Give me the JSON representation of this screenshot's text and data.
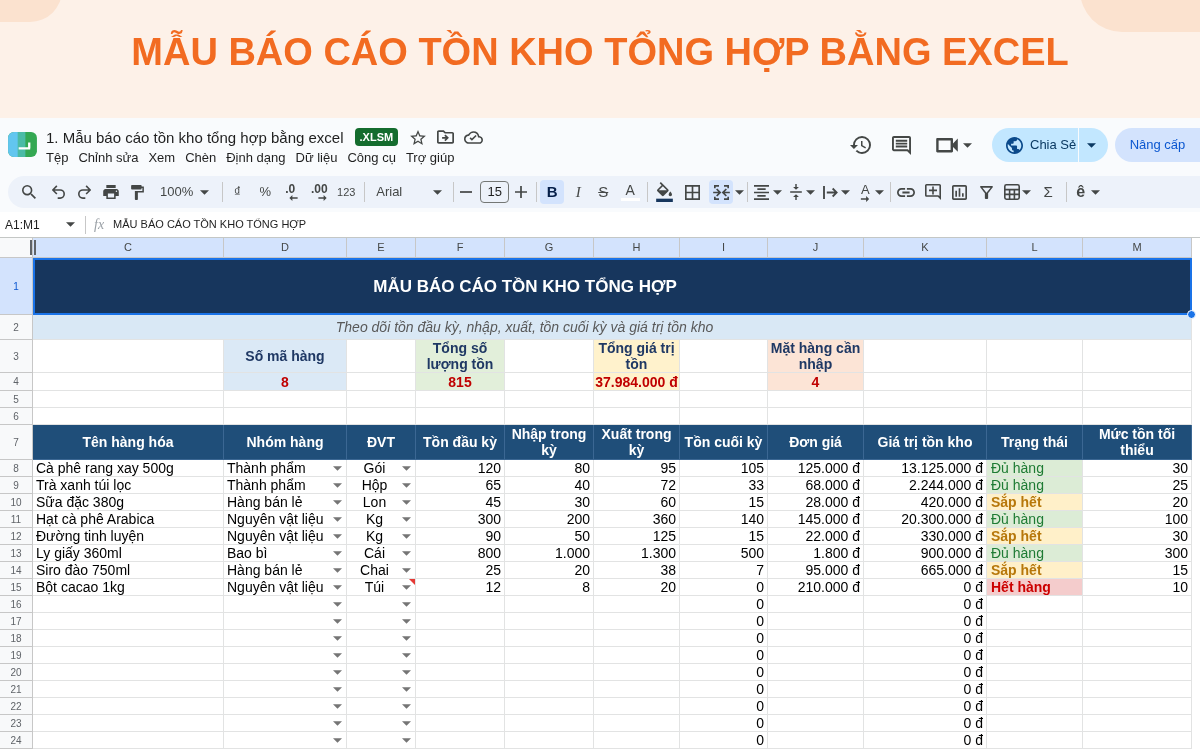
{
  "banner": {
    "title": "MẪU BÁO CÁO TỒN KHO TỔNG HỢP BẰNG EXCEL"
  },
  "header": {
    "title": "1. Mẫu báo cáo tồn kho tổng hợp bằng excel",
    "badge": ".XLSM",
    "menu": [
      "Tệp",
      "Chỉnh sửa",
      "Xem",
      "Chèn",
      "Định dạng",
      "Dữ liệu",
      "Công cụ",
      "Trợ giúp"
    ],
    "share": "Chia Sẻ",
    "upgrade": "Nâng cấp"
  },
  "toolbar": {
    "zoom": "100%",
    "currency": "₫",
    "percent": "%",
    "decrease_decimals": ".0",
    "increase_decimals": ".00",
    "number_format": "123",
    "font": "Arial",
    "font_size": "15",
    "bold": {
      "label": "B",
      "on": true
    },
    "italic": {
      "label": "I",
      "on": false
    },
    "strikethrough": {
      "label": "S",
      "on": false
    },
    "text_color": "A",
    "merge": {
      "on": true
    },
    "text_rotation": "A",
    "functions": "Σ",
    "input_tools": "ê"
  },
  "formula_bar": {
    "name_box": "A1:M1",
    "fx": "fx",
    "formula": "MẪU BÁO CÁO TỒN KHO TỔNG HỢP"
  },
  "sheet": {
    "columns": [
      "C",
      "D",
      "E",
      "F",
      "G",
      "H",
      "I",
      "J",
      "K",
      "L",
      "M"
    ],
    "title": {
      "row": "1",
      "text": "MẪU BÁO CÁO TỒN KHO TỔNG HỢP",
      "selected": true
    },
    "subtitle": {
      "row": "2",
      "text": "Theo dõi tồn đầu kỳ, nhập, xuất, tồn cuối kỳ và giá trị tồn kho"
    },
    "summary_rows": {
      "label_row": "3",
      "value_row": "4"
    },
    "summary": [
      {
        "label": "Số mã hàng",
        "value": "8",
        "color": "#dbe9f6"
      },
      {
        "label": "Tổng số lượng tồn",
        "value": "815",
        "color": "#e2efda"
      },
      {
        "label": "Tổng giá trị tồn",
        "value": "37.984.000 đ",
        "color": "#fff2cc"
      },
      {
        "label": "Mặt hàng cần nhập",
        "value": "4",
        "color": "#fce4d6"
      }
    ],
    "blank_rows": [
      "5",
      "6"
    ],
    "header": {
      "row": "7",
      "cells": [
        "Tên hàng hóa",
        "Nhóm hàng",
        "ĐVT",
        "Tồn đầu kỳ",
        "Nhập trong kỳ",
        "Xuất trong kỳ",
        "Tồn cuối kỳ",
        "Đơn giá",
        "Giá trị tồn kho",
        "Trạng thái",
        "Mức tồn tối thiểu"
      ]
    },
    "rows": [
      {
        "row": "8",
        "item": "Cà phê rang xay 500g",
        "group": "Thành phẩm",
        "unit": "Gói",
        "unit_note": false,
        "opening": "120",
        "received": "80",
        "issued": "95",
        "closing": "105",
        "unit_price": "125.000 đ",
        "stock_value": "13.125.000 đ",
        "status": {
          "text": "Đủ hàng",
          "kind": "ok"
        },
        "min_stock": "30"
      },
      {
        "row": "9",
        "item": "Trà xanh túi lọc",
        "group": "Thành phẩm",
        "unit": "Hộp",
        "unit_note": false,
        "opening": "65",
        "received": "40",
        "issued": "72",
        "closing": "33",
        "unit_price": "68.000 đ",
        "stock_value": "2.244.000 đ",
        "status": {
          "text": "Đủ hàng",
          "kind": "ok"
        },
        "min_stock": "25"
      },
      {
        "row": "10",
        "item": "Sữa đặc 380g",
        "group": "Hàng bán lẻ",
        "unit": "Lon",
        "unit_note": false,
        "opening": "45",
        "received": "30",
        "issued": "60",
        "closing": "15",
        "unit_price": "28.000 đ",
        "stock_value": "420.000 đ",
        "status": {
          "text": "Sắp hết",
          "kind": "low"
        },
        "min_stock": "20"
      },
      {
        "row": "11",
        "item": "Hạt cà phê Arabica",
        "group": "Nguyên vật liệu",
        "unit": "Kg",
        "unit_note": false,
        "opening": "300",
        "received": "200",
        "issued": "360",
        "closing": "140",
        "unit_price": "145.000 đ",
        "stock_value": "20.300.000 đ",
        "status": {
          "text": "Đủ hàng",
          "kind": "ok"
        },
        "min_stock": "100"
      },
      {
        "row": "12",
        "item": "Đường tinh luyện",
        "group": "Nguyên vật liệu",
        "unit": "Kg",
        "unit_note": false,
        "opening": "90",
        "received": "50",
        "issued": "125",
        "closing": "15",
        "unit_price": "22.000 đ",
        "stock_value": "330.000 đ",
        "status": {
          "text": "Sắp hết",
          "kind": "low"
        },
        "min_stock": "30"
      },
      {
        "row": "13",
        "item": "Ly giấy 360ml",
        "group": "Bao bì",
        "unit": "Cái",
        "unit_note": false,
        "opening": "800",
        "received": "1.000",
        "issued": "1.300",
        "closing": "500",
        "unit_price": "1.800 đ",
        "stock_value": "900.000 đ",
        "status": {
          "text": "Đủ hàng",
          "kind": "ok"
        },
        "min_stock": "300"
      },
      {
        "row": "14",
        "item": "Siro đào 750ml",
        "group": "Hàng bán lẻ",
        "unit": "Chai",
        "unit_note": false,
        "opening": "25",
        "received": "20",
        "issued": "38",
        "closing": "7",
        "unit_price": "95.000 đ",
        "stock_value": "665.000 đ",
        "status": {
          "text": "Sắp hết",
          "kind": "low"
        },
        "min_stock": "15"
      },
      {
        "row": "15",
        "item": "Bột cacao 1kg",
        "group": "Nguyên vật liệu",
        "unit": "Túi",
        "unit_note": true,
        "opening": "12",
        "received": "8",
        "issued": "20",
        "closing": "0",
        "unit_price": "210.000 đ",
        "stock_value": "0 đ",
        "status": {
          "text": "Hết hàng",
          "kind": "out"
        },
        "min_stock": "10"
      },
      {
        "row": "16",
        "unit_note": false,
        "closing": "0",
        "stock_value": "0 đ"
      },
      {
        "row": "17",
        "unit_note": false,
        "closing": "0",
        "stock_value": "0 đ"
      },
      {
        "row": "18",
        "unit_note": false,
        "closing": "0",
        "stock_value": "0 đ"
      },
      {
        "row": "19",
        "unit_note": false,
        "closing": "0",
        "stock_value": "0 đ"
      },
      {
        "row": "20",
        "unit_note": false,
        "closing": "0",
        "stock_value": "0 đ"
      },
      {
        "row": "21",
        "unit_note": false,
        "closing": "0",
        "stock_value": "0 đ"
      },
      {
        "row": "22",
        "unit_note": false,
        "closing": "0",
        "stock_value": "0 đ"
      },
      {
        "row": "23",
        "unit_note": false,
        "closing": "0",
        "stock_value": "0 đ"
      },
      {
        "row": "24",
        "unit_note": false,
        "closing": "0",
        "stock_value": "0 đ"
      }
    ]
  }
}
